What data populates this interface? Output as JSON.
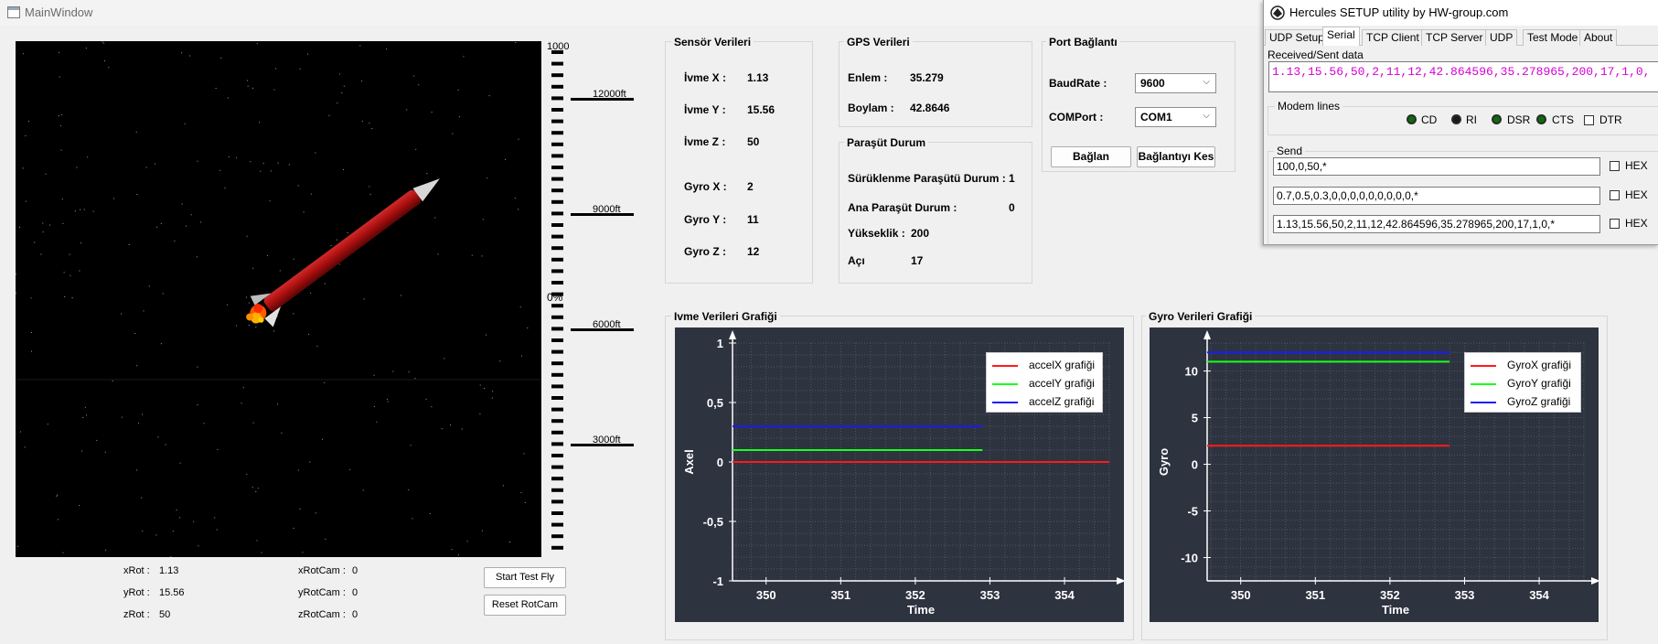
{
  "window": {
    "title": "MainWindow"
  },
  "altimeter": {
    "top_label": "1000",
    "percent_label": "0%",
    "marks": [
      "12000ft",
      "9000ft",
      "6000ft",
      "3000ft"
    ]
  },
  "rotation": {
    "xrot_label": "xRot :",
    "xrot": "1.13",
    "yrot_label": "yRot :",
    "yrot": "15.56",
    "zrot_label": "zRot :",
    "zrot": "50",
    "xrotcam_label": "xRotCam :",
    "xrotcam": "0",
    "yrotcam_label": "yRotCam :",
    "yrotcam": "0",
    "zrotcam_label": "zRotCam :",
    "zrotcam": "0"
  },
  "buttons": {
    "start": "Start Test Fly",
    "reset": "Reset RotCam"
  },
  "sensor": {
    "title": "Sensör Verileri",
    "rows": [
      {
        "label": "İvme X :",
        "value": "1.13"
      },
      {
        "label": "İvme Y :",
        "value": "15.56"
      },
      {
        "label": "İvme Z :",
        "value": "50"
      },
      {
        "label": "Gyro X :",
        "value": "2"
      },
      {
        "label": "Gyro Y :",
        "value": "11"
      },
      {
        "label": "Gyro Z :",
        "value": "12"
      }
    ]
  },
  "gps": {
    "title": "GPS Verileri",
    "lat_label": "Enlem :",
    "lat": "35.279",
    "lon_label": "Boylam :",
    "lon": "42.8646"
  },
  "parachute": {
    "title": "Paraşüt Durum",
    "drogue_label": "Sürüklenme Paraşütü Durum :",
    "drogue": "1",
    "main_label": "Ana Paraşüt Durum :",
    "main": "0",
    "alt_label": "Yükseklik :",
    "alt": "200",
    "angle_label": "Açı",
    "angle": "17"
  },
  "port": {
    "title": "Port Bağlantı",
    "baud_label": "BaudRate :",
    "baud": "9600",
    "com_label": "COMPort :",
    "com": "COM1",
    "connect": "Bağlan",
    "disconnect": "Bağlantıyı Kes"
  },
  "accel_group_title": "Ivme Verileri Grafiği",
  "gyro_group_title": "Gyro Verileri Grafiği",
  "chart_data": [
    {
      "type": "line",
      "xlabel": "Time",
      "ylabel": "Axel",
      "xlim": [
        349.55,
        354.6
      ],
      "ylim": [
        -1,
        1
      ],
      "xticks": [
        "350",
        "351",
        "352",
        "353",
        "354"
      ],
      "yticks": [
        "1",
        "0,5",
        "0",
        "-0,5",
        "-1"
      ],
      "grid": true,
      "legend_position": "top-right",
      "series": [
        {
          "name": "accelX grafiği",
          "color": "#ff1a1a",
          "x": [
            349.55,
            354.6
          ],
          "y": [
            0,
            0
          ]
        },
        {
          "name": "accelY grafiği",
          "color": "#1aff1a",
          "x": [
            349.55,
            352.9
          ],
          "y": [
            0.1,
            0.1
          ]
        },
        {
          "name": "accelZ grafiği",
          "color": "#1a1aff",
          "x": [
            349.55,
            352.9
          ],
          "y": [
            0.3,
            0.3
          ]
        }
      ]
    },
    {
      "type": "line",
      "xlabel": "Time",
      "ylabel": "Gyro",
      "xlim": [
        349.55,
        354.6
      ],
      "ylim": [
        -12.5,
        13
      ],
      "xticks": [
        "350",
        "351",
        "352",
        "353",
        "354"
      ],
      "yticks": [
        "10",
        "5",
        "0",
        "-5",
        "-10"
      ],
      "grid": true,
      "legend_position": "top-right",
      "series": [
        {
          "name": "GyroX grafiği",
          "color": "#ff1a1a",
          "x": [
            349.55,
            352.8
          ],
          "y": [
            2,
            2
          ]
        },
        {
          "name": "GyroY grafiği",
          "color": "#1aff1a",
          "x": [
            349.55,
            352.8
          ],
          "y": [
            11,
            11
          ]
        },
        {
          "name": "GyroZ grafiği",
          "color": "#1a1aff",
          "x": [
            349.55,
            352.8
          ],
          "y": [
            12,
            12
          ]
        }
      ]
    }
  ],
  "hercules": {
    "title": "Hercules SETUP utility by HW-group.com",
    "tabs": [
      "UDP Setup",
      "Serial",
      "TCP Client",
      "TCP Server",
      "UDP",
      "Test Mode",
      "About"
    ],
    "received_label": "Received/Sent data",
    "received": "1.13,15.56,50,2,11,12,42.864596,35.278965,200,17,1,0,",
    "modem_label": "Modem lines",
    "modem": [
      "CD",
      "RI",
      "DSR",
      "CTS",
      "DTR"
    ],
    "send_label": "Send",
    "sends": [
      "100,0,50,*",
      "0.7,0.5,0.3,0,0,0,0,0,0,0,0,0,*",
      "1.13,15.56,50,2,11,12,42.864596,35.278965,200,17,1,0,*"
    ],
    "hex_label": "HEX"
  }
}
